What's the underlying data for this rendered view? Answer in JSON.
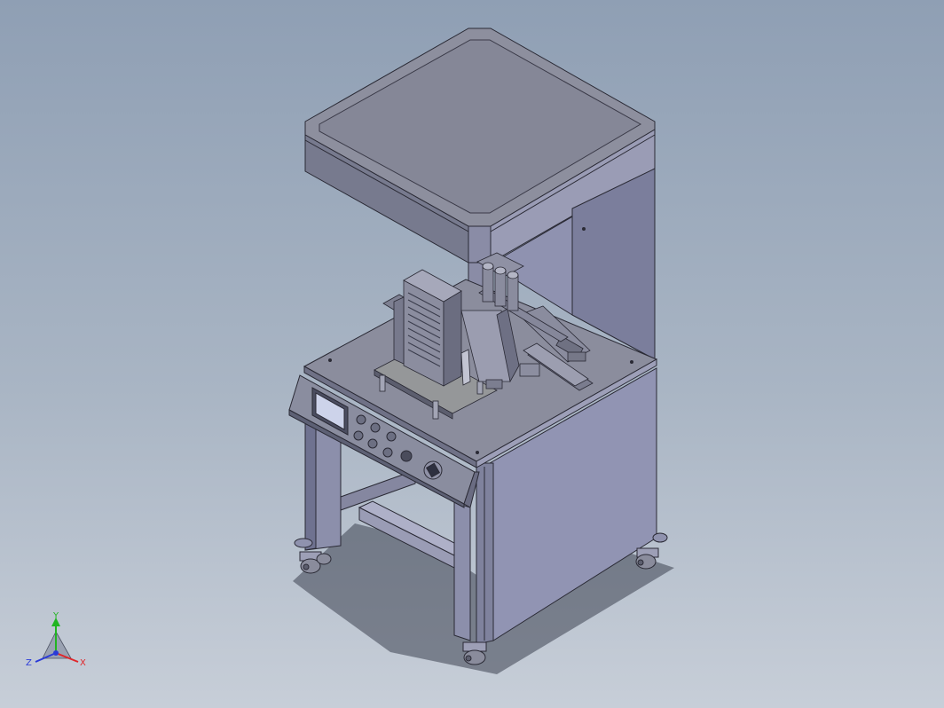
{
  "viewport": {
    "background_top": "#8f9fb4",
    "background_bottom": "#c7ced8"
  },
  "model": {
    "subject": "machine-cabinet-assembly",
    "colors": {
      "body": "#9194b3",
      "body_dark": "#6f7290",
      "body_light": "#a9abc6",
      "metal": "#8a8c9c",
      "edge": "#2a2a35",
      "screen": "#cdd3ea",
      "shadow": "#3c4250"
    }
  },
  "triad": {
    "x_label": "X",
    "y_label": "Y",
    "z_label": "Z",
    "x_color": "#e0262a",
    "y_color": "#22b522",
    "z_color": "#2a3ad8"
  }
}
